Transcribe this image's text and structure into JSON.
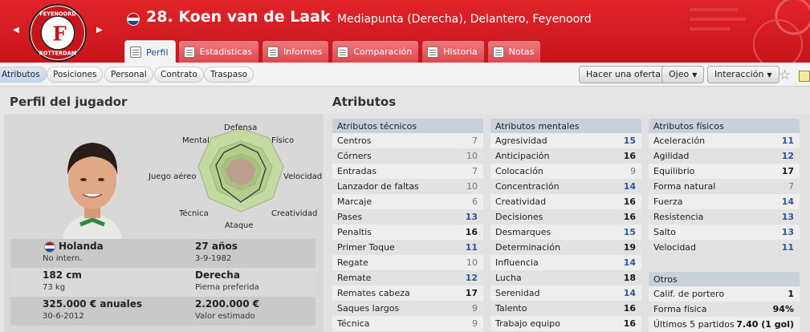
{
  "header": {
    "club_badge": "feyenoord-crest",
    "crest_text_top": "FEYENOORD",
    "crest_text_bottom": "ROTTERDAM",
    "player_title": "28. Koen van de Laak",
    "player_subtitle": "Mediapunta (Derecha), Delantero, Feyenoord"
  },
  "tabs": [
    {
      "label": "Perfil",
      "active": true
    },
    {
      "label": "Estadísticas"
    },
    {
      "label": "Informes"
    },
    {
      "label": "Comparación"
    },
    {
      "label": "Historia"
    },
    {
      "label": "Notas"
    }
  ],
  "subnav": {
    "pills": [
      "Atributos",
      "Posiciones",
      "Personal",
      "Contrato",
      "Traspaso"
    ],
    "actions": {
      "offer": "Hacer una oferta",
      "scout": "Ojeo",
      "interaction": "Interacción"
    }
  },
  "profile": {
    "title": "Perfil del jugador",
    "radar_labels": {
      "top": "Defensa",
      "top_right": "Físico",
      "right": "Velocidad",
      "bottom_right": "Creatividad",
      "bottom": "Ataque",
      "bottom_left": "Técnica",
      "left": "Juego aéreo",
      "top_left": "Mental"
    },
    "nation": "Holanda",
    "international": "No intern.",
    "age": "27 años",
    "dob": "3-9-1982",
    "height": "182 cm",
    "weight": "73 kg",
    "foot": "Derecha",
    "foot_label": "Pierna preferida",
    "wage": "325.000 € anuales",
    "contract_end": "30-6-2012",
    "value": "2.200.000 €",
    "value_label": "Valor estimado",
    "colors": {
      "flag_red": "#ae1c28",
      "flag_white": "#ffffff",
      "flag_blue": "#21468b"
    }
  },
  "attributes": {
    "title": "Atributos",
    "technical": {
      "header": "Atributos técnicos",
      "items": [
        {
          "name": "Centros",
          "value": "7"
        },
        {
          "name": "Córners",
          "value": "10"
        },
        {
          "name": "Entradas",
          "value": "7"
        },
        {
          "name": "Lanzador de faltas",
          "value": "10"
        },
        {
          "name": "Marcaje",
          "value": "6"
        },
        {
          "name": "Pases",
          "value": "13"
        },
        {
          "name": "Penaltis",
          "value": "16"
        },
        {
          "name": "Primer Toque",
          "value": "11"
        },
        {
          "name": "Regate",
          "value": "10"
        },
        {
          "name": "Remate",
          "value": "12"
        },
        {
          "name": "Remates cabeza",
          "value": "17"
        },
        {
          "name": "Saques largos",
          "value": "9"
        },
        {
          "name": "Técnica",
          "value": "9"
        }
      ]
    },
    "mental": {
      "header": "Atributos mentales",
      "items": [
        {
          "name": "Agresividad",
          "value": "15"
        },
        {
          "name": "Anticipación",
          "value": "16"
        },
        {
          "name": "Colocación",
          "value": "9"
        },
        {
          "name": "Concentración",
          "value": "14"
        },
        {
          "name": "Creatividad",
          "value": "16"
        },
        {
          "name": "Decisiones",
          "value": "16"
        },
        {
          "name": "Desmarques",
          "value": "15"
        },
        {
          "name": "Determinación",
          "value": "19"
        },
        {
          "name": "Influencia",
          "value": "14"
        },
        {
          "name": "Lucha",
          "value": "18"
        },
        {
          "name": "Serenidad",
          "value": "14"
        },
        {
          "name": "Talento",
          "value": "16"
        },
        {
          "name": "Trabajo equipo",
          "value": "16"
        }
      ]
    },
    "physical": {
      "header": "Atributos físicos",
      "items": [
        {
          "name": "Aceleración",
          "value": "11"
        },
        {
          "name": "Agilidad",
          "value": "12"
        },
        {
          "name": "Equilibrio",
          "value": "17"
        },
        {
          "name": "Forma natural",
          "value": "7"
        },
        {
          "name": "Fuerza",
          "value": "14"
        },
        {
          "name": "Resistencia",
          "value": "13"
        },
        {
          "name": "Salto",
          "value": "13"
        },
        {
          "name": "Velocidad",
          "value": "11"
        }
      ]
    },
    "others": {
      "header": "Otros",
      "items": [
        {
          "name": "Calif. de portero",
          "value": "1"
        },
        {
          "name": "Forma física",
          "value": "94%"
        },
        {
          "name": "Últimos 5 partidos",
          "value": "7.40 (1 gol)"
        }
      ]
    }
  }
}
